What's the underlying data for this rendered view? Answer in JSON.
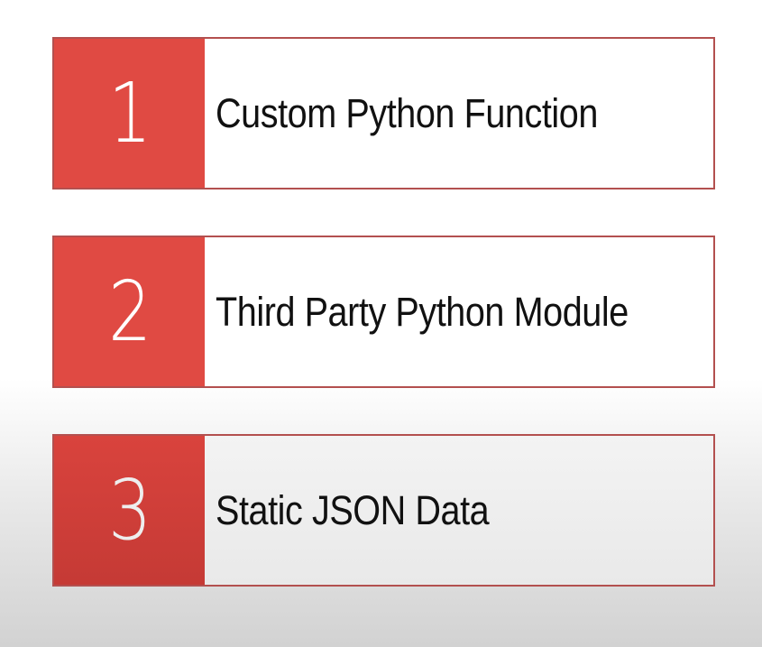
{
  "colors": {
    "accent": "#e04a43",
    "border": "#b3504f",
    "label_text": "#111111",
    "number_text": "#ffffff"
  },
  "items": [
    {
      "number": "1",
      "label": "Custom Python Function"
    },
    {
      "number": "2",
      "label": "Third Party Python Module"
    },
    {
      "number": "3",
      "label": "Static JSON Data"
    }
  ]
}
